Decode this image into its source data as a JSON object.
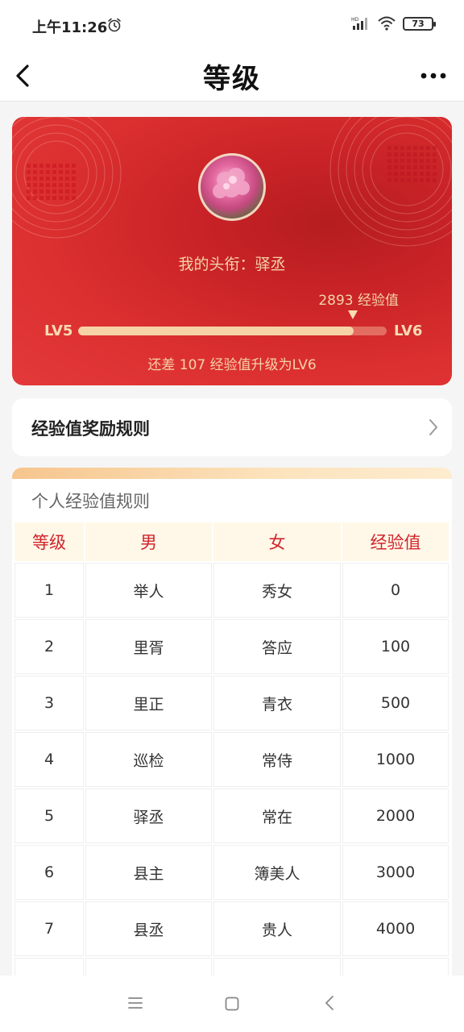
{
  "status_bar": {
    "time": "上午11:26",
    "battery": "73",
    "network": "HD",
    "icons": [
      "alarm-icon",
      "signal-icon",
      "wifi-icon",
      "battery-icon"
    ]
  },
  "nav": {
    "title": "等级",
    "icons": [
      "back-icon",
      "more-icon"
    ]
  },
  "level_card": {
    "avatar_icon": "avatar-image",
    "title_line": "我的头衔：驿丞",
    "exp_label": "2893 经验值",
    "current_level": "LV5",
    "next_level": "LV6",
    "progress": 0.893,
    "remain_line": "还差 107 经验值升级为LV6",
    "colors": {
      "card": "#dc3030",
      "accent": "#f5d3a6"
    }
  },
  "rules_entry": {
    "label": "经验值奖励规则",
    "icon": "chevron-right-icon"
  },
  "rules_table": {
    "caption": "个人经验值规则",
    "headers": [
      "等级",
      "男",
      "女",
      "经验值"
    ],
    "rows": [
      [
        "1",
        "举人",
        "秀女",
        "0"
      ],
      [
        "2",
        "里胥",
        "答应",
        "100"
      ],
      [
        "3",
        "里正",
        "青衣",
        "500"
      ],
      [
        "4",
        "巡检",
        "常侍",
        "1000"
      ],
      [
        "5",
        "驿丞",
        "常在",
        "2000"
      ],
      [
        "6",
        "县主",
        "簿美人",
        "3000"
      ],
      [
        "7",
        "县丞",
        "贵人",
        "4000"
      ]
    ],
    "header_color": "#d2242b"
  },
  "system_nav": {
    "icons": [
      "menu-icon",
      "home-icon",
      "back-nav-icon"
    ]
  }
}
